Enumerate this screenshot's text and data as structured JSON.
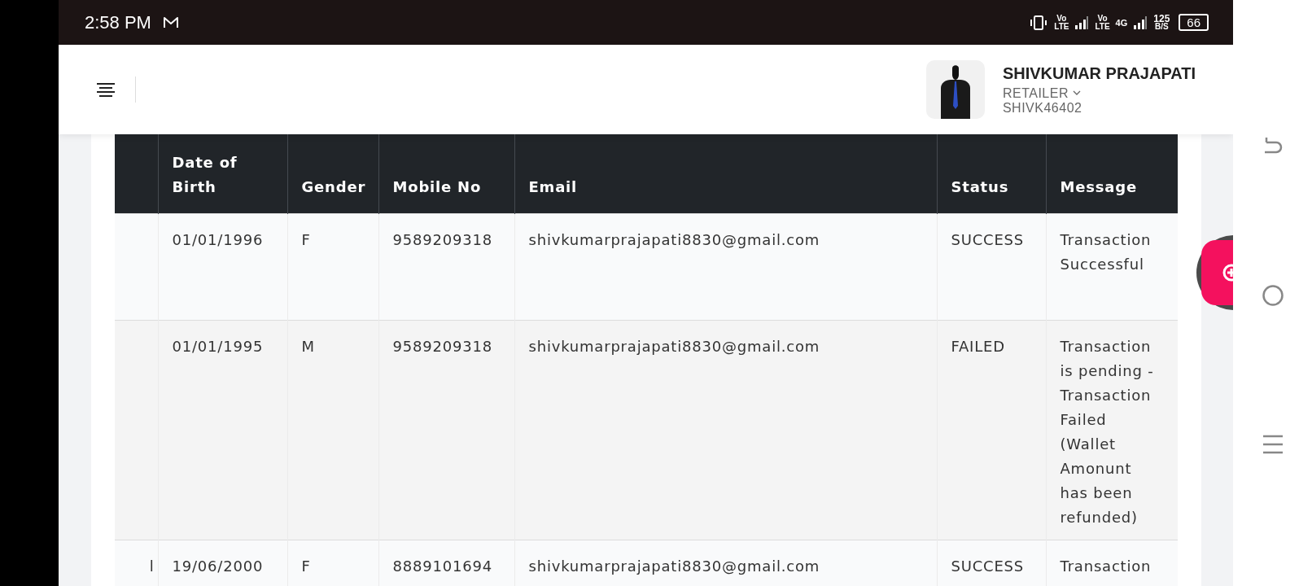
{
  "status_bar": {
    "time": "2:58 PM",
    "signals": [
      {
        "top": "Vo",
        "bottom": "LTE"
      },
      {
        "top": "Vo",
        "bottom": "LTE"
      }
    ],
    "network_type": "4G",
    "speed": "125",
    "speed_unit": "B/S",
    "battery": "66"
  },
  "user": {
    "name": "SHIVKUMAR PRAJAPATI",
    "role": "RETAILER",
    "id": "SHIVK46402"
  },
  "table": {
    "columns": [
      "Date of Birth",
      "Gender",
      "Mobile No",
      "Email",
      "Status",
      "Message"
    ],
    "rows": [
      {
        "date_of_birth": "01/01/1996",
        "gender": "F",
        "mobile_no": "9589209318",
        "email": "shivkumarprajapati8830@gmail.com",
        "status": "SUCCESS",
        "message": "Transaction Successful"
      },
      {
        "date_of_birth": "01/01/1995",
        "gender": "M",
        "mobile_no": "9589209318",
        "email": "shivkumarprajapati8830@gmail.com",
        "status": "FAILED",
        "message": "Transaction is pending - Transaction Failed (Wallet Amonunt has been refunded)"
      },
      {
        "column_1": "l",
        "date_of_birth": "19/06/2000",
        "gender": "F",
        "mobile_no": "8889101694",
        "email": "shivkumarprajapati8830@gmail.com",
        "status": "SUCCESS",
        "message": "Transaction"
      }
    ]
  }
}
